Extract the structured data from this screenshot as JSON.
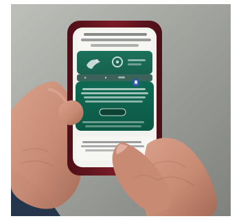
{
  "colors": {
    "frame": "#ffffff",
    "background": "#9a9c98",
    "background_light": "#c7c8c4",
    "shirt": "#1f2f47",
    "skin": "#c99079",
    "skin_shadow": "#9e6656",
    "phone_case": "#6b1620",
    "screen_green": "#0f6a52",
    "screen_white": "#f2f2ee"
  },
  "icons": {
    "nav_icon": "bird-icon",
    "badge_icon": "gear-icon",
    "action_button": "pill-button",
    "bookmark_icon": "bookmark-icon"
  },
  "phone": {
    "header_text": "",
    "body_text": "",
    "button_text": "",
    "footer_text": ""
  }
}
